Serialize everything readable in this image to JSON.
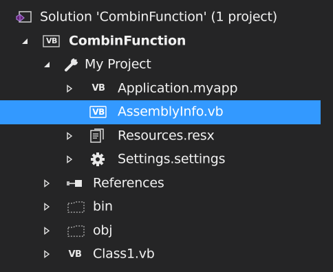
{
  "solution_explorer": {
    "solution_label": "Solution 'CombinFunction' (1 project)",
    "project_label": "CombinFunction",
    "items": [
      {
        "label": "My Project"
      },
      {
        "label": "Application.myapp"
      },
      {
        "label": "AssemblyInfo.vb"
      },
      {
        "label": "Resources.resx"
      },
      {
        "label": "Settings.settings"
      },
      {
        "label": "References"
      },
      {
        "label": "bin"
      },
      {
        "label": "obj"
      },
      {
        "label": "Class1.vb"
      }
    ],
    "selected_item": "AssemblyInfo.vb",
    "icons": {
      "solution": "vs-solution-icon",
      "project": "vb-project-icon",
      "my_project": "wrench-icon",
      "vb_file": "vb-file-icon",
      "resx": "resource-file-icon",
      "settings": "gear-icon",
      "references": "references-icon",
      "folder": "dashed-folder-icon"
    },
    "badge_text": "VB",
    "colors": {
      "background": "#252526",
      "text": "#f1f1f1",
      "selection": "#3399ff",
      "vs_purple": "#68217a"
    }
  }
}
